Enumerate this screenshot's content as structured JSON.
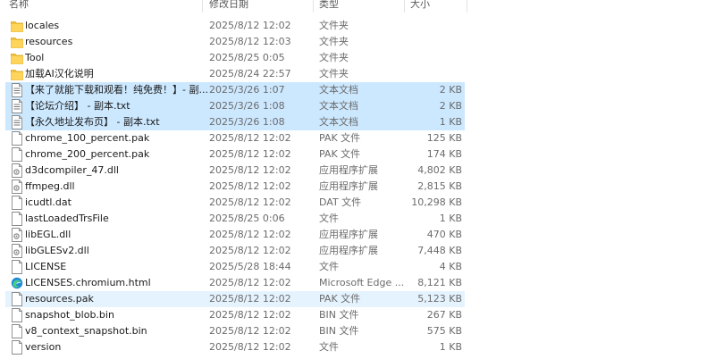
{
  "columns": {
    "name": "名称",
    "date": "修改日期",
    "type": "类型",
    "size": "大小"
  },
  "icons": {
    "folder": "folder-icon",
    "txt": "text-file-icon",
    "file": "file-icon",
    "dll": "dll-file-icon",
    "edge": "edge-browser-icon"
  },
  "files": [
    {
      "name": "locales",
      "date": "2025/8/12 12:02",
      "type": "文件夹",
      "size": "",
      "icon": "folder",
      "state": ""
    },
    {
      "name": "resources",
      "date": "2025/8/12 12:03",
      "type": "文件夹",
      "size": "",
      "icon": "folder",
      "state": ""
    },
    {
      "name": "Tool",
      "date": "2025/8/25 0:05",
      "type": "文件夹",
      "size": "",
      "icon": "folder",
      "state": ""
    },
    {
      "name": "加载AI汉化说明",
      "date": "2025/8/24 22:57",
      "type": "文件夹",
      "size": "",
      "icon": "folder",
      "state": ""
    },
    {
      "name": "【来了就能下载和观看！纯免费！】- 副...",
      "date": "2025/3/26 1:07",
      "type": "文本文档",
      "size": "2 KB",
      "icon": "txt",
      "state": "sel"
    },
    {
      "name": "【论坛介绍】 - 副本.txt",
      "date": "2025/3/26 1:08",
      "type": "文本文档",
      "size": "2 KB",
      "icon": "txt",
      "state": "sel"
    },
    {
      "name": "【永久地址发布页】 - 副本.txt",
      "date": "2025/3/26 1:08",
      "type": "文本文档",
      "size": "1 KB",
      "icon": "txt",
      "state": "sel"
    },
    {
      "name": "chrome_100_percent.pak",
      "date": "2025/8/12 12:02",
      "type": "PAK 文件",
      "size": "125 KB",
      "icon": "file",
      "state": ""
    },
    {
      "name": "chrome_200_percent.pak",
      "date": "2025/8/12 12:02",
      "type": "PAK 文件",
      "size": "174 KB",
      "icon": "file",
      "state": ""
    },
    {
      "name": "d3dcompiler_47.dll",
      "date": "2025/8/12 12:02",
      "type": "应用程序扩展",
      "size": "4,802 KB",
      "icon": "dll",
      "state": ""
    },
    {
      "name": "ffmpeg.dll",
      "date": "2025/8/12 12:02",
      "type": "应用程序扩展",
      "size": "2,815 KB",
      "icon": "dll",
      "state": ""
    },
    {
      "name": "icudtl.dat",
      "date": "2025/8/12 12:02",
      "type": "DAT 文件",
      "size": "10,298 KB",
      "icon": "file",
      "state": ""
    },
    {
      "name": "lastLoadedTrsFile",
      "date": "2025/8/25 0:06",
      "type": "文件",
      "size": "1 KB",
      "icon": "file",
      "state": ""
    },
    {
      "name": "libEGL.dll",
      "date": "2025/8/12 12:02",
      "type": "应用程序扩展",
      "size": "470 KB",
      "icon": "dll",
      "state": ""
    },
    {
      "name": "libGLESv2.dll",
      "date": "2025/8/12 12:02",
      "type": "应用程序扩展",
      "size": "7,448 KB",
      "icon": "dll",
      "state": ""
    },
    {
      "name": "LICENSE",
      "date": "2025/5/28 18:44",
      "type": "文件",
      "size": "4 KB",
      "icon": "file",
      "state": ""
    },
    {
      "name": "LICENSES.chromium.html",
      "date": "2025/8/12 12:02",
      "type": "Microsoft Edge ...",
      "size": "8,121 KB",
      "icon": "edge",
      "state": ""
    },
    {
      "name": "resources.pak",
      "date": "2025/8/12 12:02",
      "type": "PAK 文件",
      "size": "5,123 KB",
      "icon": "file",
      "state": "sel-light"
    },
    {
      "name": "snapshot_blob.bin",
      "date": "2025/8/12 12:02",
      "type": "BIN 文件",
      "size": "267 KB",
      "icon": "file",
      "state": ""
    },
    {
      "name": "v8_context_snapshot.bin",
      "date": "2025/8/12 12:02",
      "type": "BIN 文件",
      "size": "575 KB",
      "icon": "file",
      "state": ""
    },
    {
      "name": "version",
      "date": "2025/8/12 12:02",
      "type": "文件",
      "size": "1 KB",
      "icon": "file",
      "state": ""
    }
  ]
}
